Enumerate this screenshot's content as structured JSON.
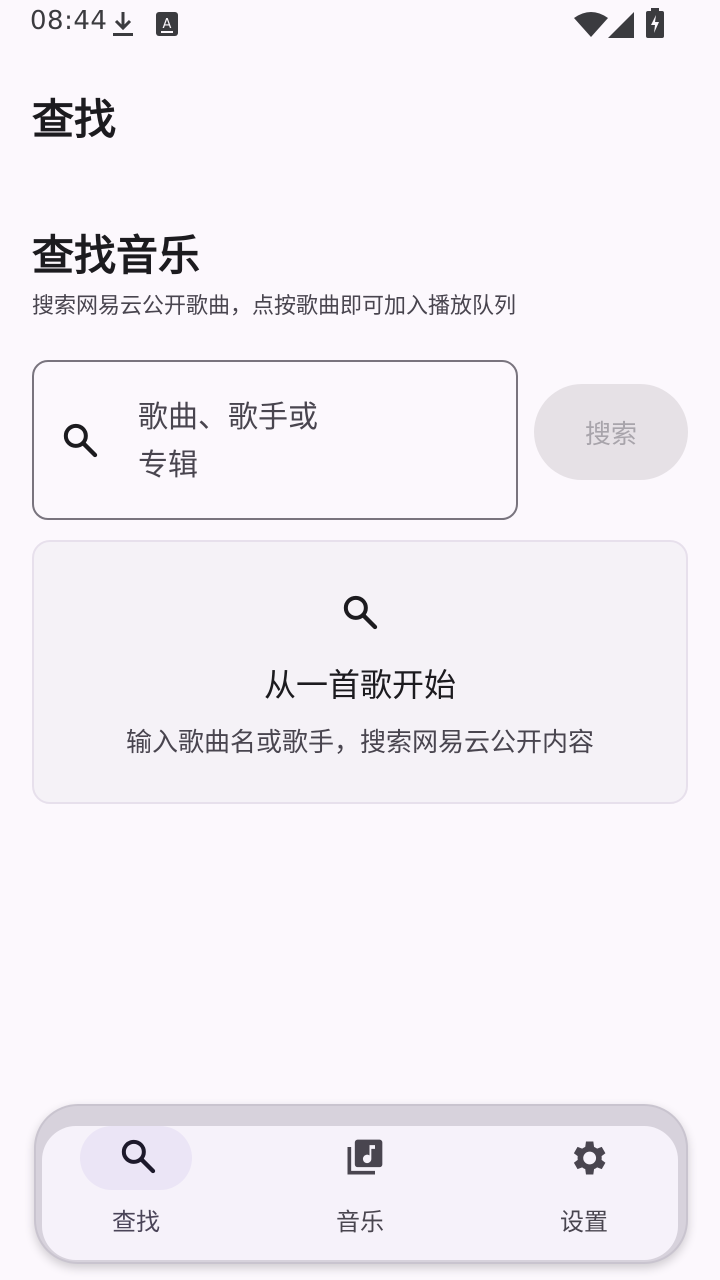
{
  "status_bar": {
    "time": "08:44",
    "icons": [
      "download-icon",
      "keyboard-a-icon",
      "wifi-icon",
      "signal-icon",
      "battery-charging-icon"
    ]
  },
  "app_bar": {
    "title": "查找"
  },
  "search_section": {
    "title": "查找音乐",
    "subtitle": "搜索网易云公开歌曲，点按歌曲即可加入播放队列",
    "input": {
      "placeholder_line1": "歌曲、歌手或",
      "placeholder_line2": "专辑",
      "icon": "search-icon"
    },
    "button_label": "搜索"
  },
  "empty_state": {
    "icon": "search-icon",
    "title": "从一首歌开始",
    "description": "输入歌曲名或歌手，搜索网易云公开内容"
  },
  "bottom_nav": {
    "items": [
      {
        "label": "查找",
        "icon": "search-icon",
        "active": true
      },
      {
        "label": "音乐",
        "icon": "library-music-icon",
        "active": false
      },
      {
        "label": "设置",
        "icon": "gear-icon",
        "active": false
      }
    ]
  },
  "colors": {
    "background": "#fcf8fd",
    "outline": "#79747e",
    "disabled_button": "#e6e1e6",
    "card_background": "#f5f2f7",
    "nav_active_pill": "#ebe5f6"
  }
}
